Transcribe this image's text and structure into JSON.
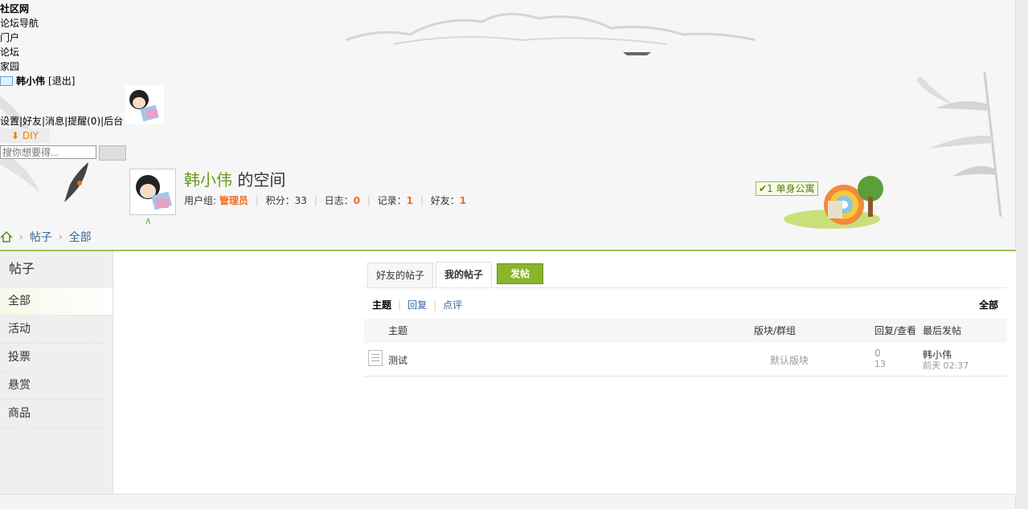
{
  "site": {
    "title": "社区网",
    "nav_label": "论坛导航",
    "nav_items": [
      "门户",
      "论坛",
      "家园"
    ]
  },
  "user": {
    "name": "韩小伟",
    "logout": "[退出]",
    "menu": "设置|好友|消息|提醒(0)|后台",
    "diy": "DIY"
  },
  "search": {
    "placeholder": "搜你想要得..."
  },
  "space": {
    "title_name": "韩小伟",
    "title_suffix": " 的空间",
    "group_label": "用户组: ",
    "group_value": "管理员",
    "points_label": "积分：",
    "points_value": "33",
    "blog_label": "日志：",
    "blog_value": "0",
    "record_label": "记录：",
    "record_value": "1",
    "friends_label": "好友：",
    "friends_value": "1",
    "badge_level": "1",
    "badge_text": "单身公寓"
  },
  "breadcrumb": {
    "items": [
      "帖子",
      "全部"
    ]
  },
  "sidebar": {
    "header": "帖子",
    "items": [
      {
        "label": "全部"
      },
      {
        "label": "活动"
      },
      {
        "label": "投票"
      },
      {
        "label": "悬赏"
      },
      {
        "label": "商品"
      }
    ]
  },
  "tabs": {
    "friends": "好友的帖子",
    "mine": "我的帖子",
    "post": "发帖"
  },
  "filters": {
    "topic": "主题",
    "reply": "回复",
    "comment": "点评",
    "all": "全部"
  },
  "table": {
    "headers": {
      "subject": "主题",
      "forum": "版块/群组",
      "reply_view": "回复/查看",
      "last_post": "最后发帖"
    },
    "rows": [
      {
        "subject": "测试",
        "forum": "默认版块",
        "replies": "0",
        "views": "13",
        "last_user": "韩小伟",
        "last_time": "前天 02:37"
      }
    ]
  },
  "colors": {
    "accent_green": "#8ab42c",
    "link_blue": "#336699",
    "highlight_orange": "#f26c20"
  }
}
